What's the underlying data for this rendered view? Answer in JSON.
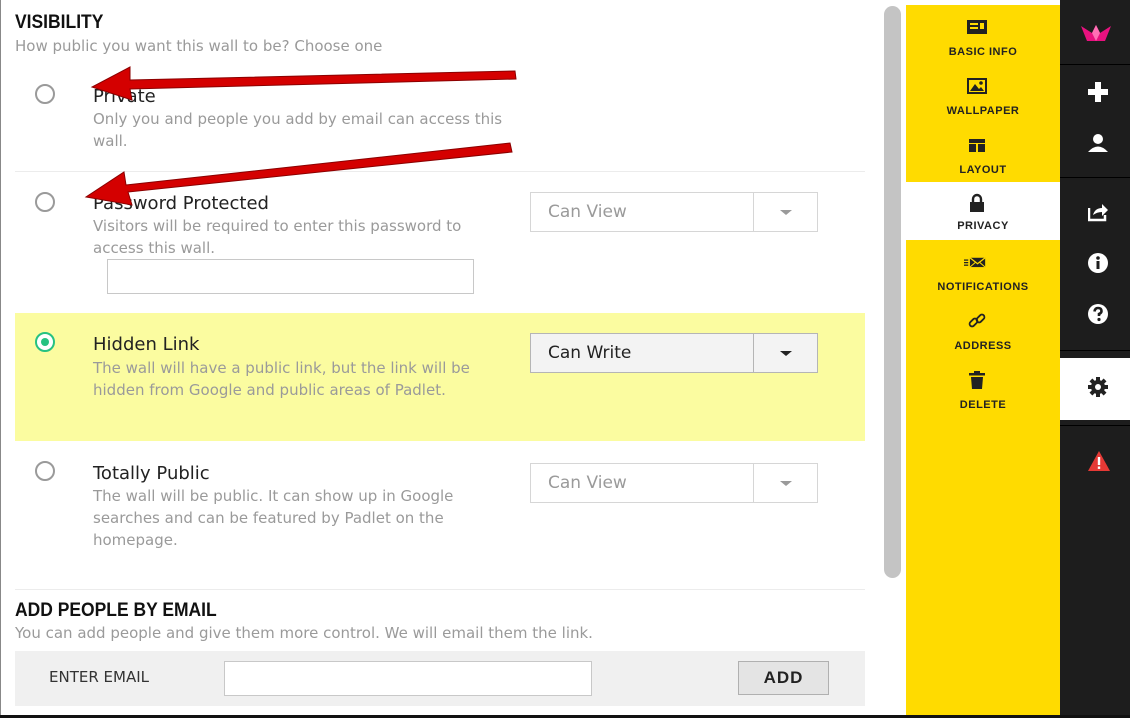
{
  "visibility": {
    "title": "VISIBILITY",
    "subtitle": "How public you want this wall to be? Choose one",
    "options": [
      {
        "title": "Private",
        "description": "Only you and people you add by email can access this wall.",
        "selected": false
      },
      {
        "title": "Password Protected",
        "description": "Visitors will be required to enter this password to access this wall.",
        "permission": "Can View",
        "selected": false
      },
      {
        "title": "Hidden Link",
        "description": "The wall will have a public link, but the link will be hidden from Google and public areas of Padlet.",
        "permission": "Can Write",
        "selected": true
      },
      {
        "title": "Totally Public",
        "description": "The wall will be public. It can show up in Google searches and can be featured by Padlet on the homepage.",
        "permission": "Can View",
        "selected": false
      }
    ]
  },
  "add_people": {
    "title": "ADD PEOPLE BY EMAIL",
    "subtitle": "You can add people and give them more control. We will email them the link.",
    "email_label": "ENTER EMAIL",
    "email_value": "",
    "add_label": "ADD"
  },
  "settings_menu": {
    "items": [
      {
        "label": "BASIC INFO",
        "icon": "newspaper-icon",
        "active": false
      },
      {
        "label": "WALLPAPER",
        "icon": "image-icon",
        "active": false
      },
      {
        "label": "LAYOUT",
        "icon": "layout-icon",
        "active": false
      },
      {
        "label": "PRIVACY",
        "icon": "lock-icon",
        "active": true
      },
      {
        "label": "NOTIFICATIONS",
        "icon": "envelope-icon",
        "active": false
      },
      {
        "label": "ADDRESS",
        "icon": "link-icon",
        "active": false
      },
      {
        "label": "DELETE",
        "icon": "trash-icon",
        "active": false
      }
    ]
  },
  "toolbar": {
    "items": [
      "padlet-logo-icon",
      "plus-icon",
      "user-icon",
      "share-icon",
      "info-icon",
      "help-icon",
      "gear-icon",
      "warning-icon"
    ],
    "active": "gear-icon"
  },
  "colors": {
    "menu_yellow": "#ffdb00",
    "selected_bg": "#fbfca0",
    "radio_on": "#26c281",
    "toolbar_dark": "#1d1d1d",
    "arrow_red": "#d40000",
    "logo_pink": "#e8117f",
    "warning_red": "#e53935"
  }
}
